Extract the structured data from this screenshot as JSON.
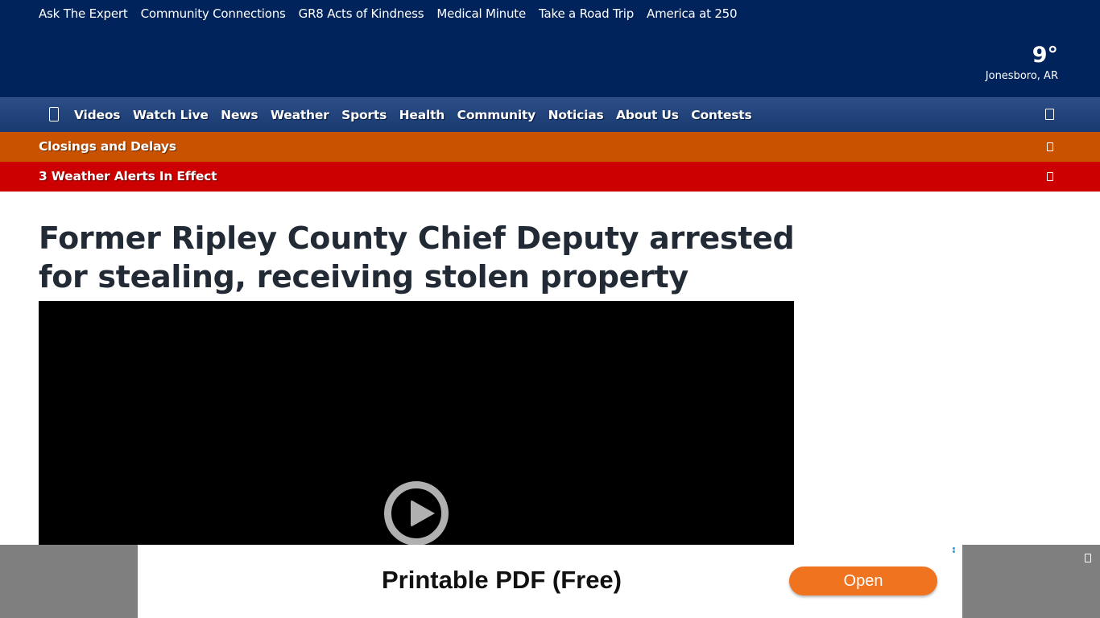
{
  "top_links": [
    "Ask The Expert",
    "Community Connections",
    "GR8 Acts of Kindness",
    "Medical Minute",
    "Take a Road Trip",
    "America at 250"
  ],
  "weather": {
    "temperature": "9°",
    "city": "Jonesboro, AR"
  },
  "main_nav": {
    "menu_icon": "hamburger-menu-icon",
    "items": [
      "Videos",
      "Watch Live",
      "News",
      "Weather",
      "Sports",
      "Health",
      "Community",
      "Noticias",
      "About Us",
      "Contests"
    ],
    "search_icon": "search-icon"
  },
  "closings_bar": {
    "label": "Closings and Delays",
    "icon": "chevron-icon",
    "color": "#c85200"
  },
  "alerts_bar": {
    "label": "3 Weather Alerts In Effect",
    "icon": "chevron-icon",
    "color": "#cc0000"
  },
  "article": {
    "headline": "Former Ripley County Chief Deputy arrested for stealing, receiving stolen property"
  },
  "video": {
    "icon": "play-icon"
  },
  "ad": {
    "title": "Printable PDF (Free)",
    "button_label": "Open",
    "button_color": "#f07320",
    "close_icon": "close-icon",
    "choices_icon": "ad-choices-icon"
  },
  "colors": {
    "header_bg": "#00235b",
    "nav_bg": "#1f4178"
  }
}
